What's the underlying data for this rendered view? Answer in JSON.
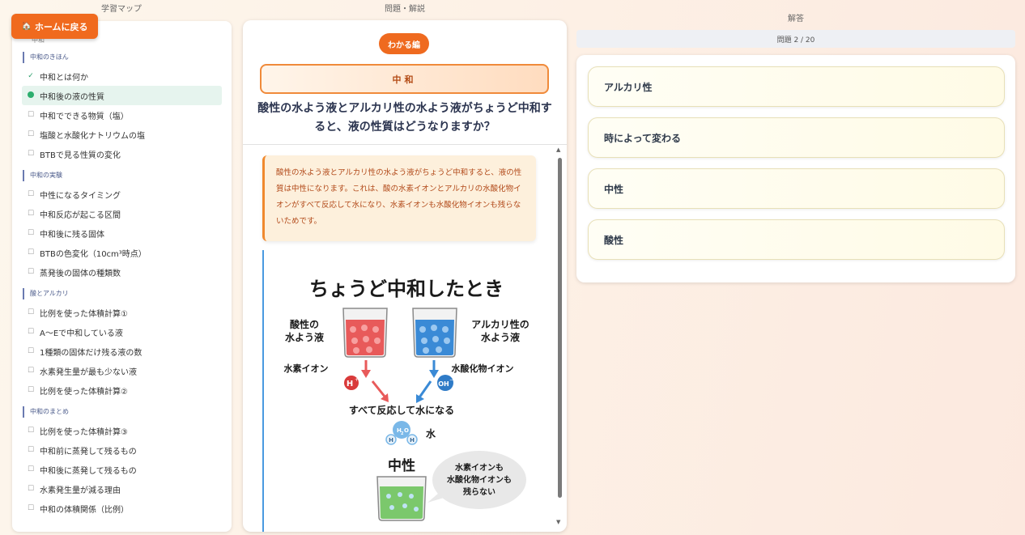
{
  "headers": {
    "map": "学習マップ",
    "question": "問題・解説",
    "answer": "解答"
  },
  "home_button": {
    "icon": "house-icon",
    "label": "ホームに戻る"
  },
  "sidebar": {
    "top_label": "中和",
    "sections": [
      {
        "title": "中和のきほん",
        "items": [
          {
            "label": "中和とは何か",
            "state": "done"
          },
          {
            "label": "中和後の液の性質",
            "state": "current"
          },
          {
            "label": "中和でできる物質（塩）",
            "state": "todo"
          },
          {
            "label": "塩酸と水酸化ナトリウムの塩",
            "state": "todo"
          },
          {
            "label": "BTBで見る性質の変化",
            "state": "todo"
          }
        ]
      },
      {
        "title": "中和の実験",
        "items": [
          {
            "label": "中性になるタイミング",
            "state": "todo"
          },
          {
            "label": "中和反応が起こる区間",
            "state": "todo"
          },
          {
            "label": "中和後に残る固体",
            "state": "todo"
          },
          {
            "label": "BTBの色変化（10cm³時点）",
            "state": "todo"
          },
          {
            "label": "蒸発後の固体の種類数",
            "state": "todo"
          }
        ]
      },
      {
        "title": "酸とアルカリ",
        "items": [
          {
            "label": "比例を使った体積計算①",
            "state": "todo"
          },
          {
            "label": "A〜Eで中和している液",
            "state": "todo"
          },
          {
            "label": "1種類の固体だけ残る液の数",
            "state": "todo"
          },
          {
            "label": "水素発生量が最も少ない液",
            "state": "todo"
          },
          {
            "label": "比例を使った体積計算②",
            "state": "todo"
          }
        ]
      },
      {
        "title": "中和のまとめ",
        "items": [
          {
            "label": "比例を使った体積計算③",
            "state": "todo"
          },
          {
            "label": "中和前に蒸発して残るもの",
            "state": "todo"
          },
          {
            "label": "中和後に蒸発して残るもの",
            "state": "todo"
          },
          {
            "label": "水素発生量が減る理由",
            "state": "todo"
          },
          {
            "label": "中和の体積関係（比例）",
            "state": "todo"
          }
        ]
      }
    ]
  },
  "question_panel": {
    "badge": "わかる編",
    "topic": "中和",
    "question": "酸性の水よう液とアルカリ性の水よう液がちょうど中和すると、液の性質はどうなりますか？",
    "explanation": "酸性の水よう液とアルカリ性の水よう液がちょうど中和すると、液の性質は中性になります。これは、酸の水素イオンとアルカリの水酸化物イオンがすべて反応して水になり、水素イオンも水酸化物イオンも残らないためです。",
    "figure": {
      "title": "ちょうど中和したとき",
      "acid_label_1": "酸性の",
      "acid_label_2": "水よう液",
      "alkali_label_1": "アルカリ性の",
      "alkali_label_2": "水よう液",
      "hydrogen_ion": "水素イオン",
      "hydroxide_ion": "水酸化物イオン",
      "h_symbol": "H",
      "plus": "+",
      "oh_symbol": "OH",
      "minus": "−",
      "reaction": "すべて反応して水になる",
      "water": "水",
      "h2o_h": "H",
      "h2o_2": "2",
      "h2o_o": "O",
      "neutral": "中性",
      "bubble_1": "水素イオンも",
      "bubble_2": "水酸化物イオンも",
      "bubble_3": "残らない",
      "acid_color": "#e85a5a",
      "alkali_color": "#3a8ad6",
      "neutral_color": "#7bc86c"
    }
  },
  "answer_panel": {
    "progress": "問題 2 / 20",
    "choices": [
      "アルカリ性",
      "時によって変わる",
      "中性",
      "酸性"
    ]
  }
}
